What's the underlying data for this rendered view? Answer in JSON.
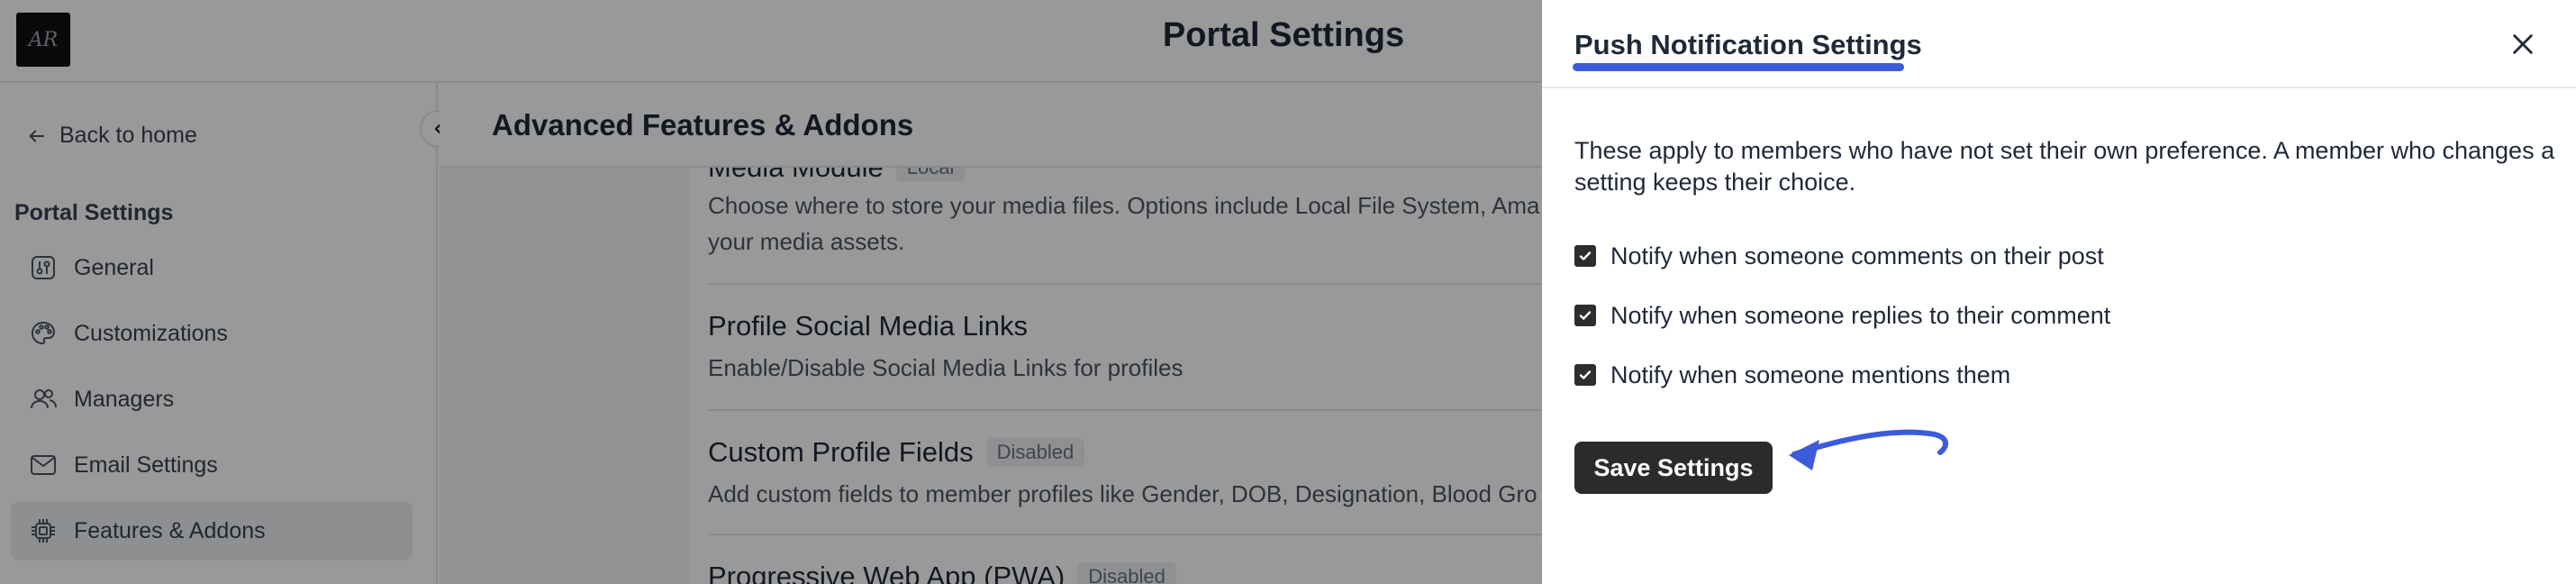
{
  "app": {
    "logo_text": "AR",
    "title": "Portal Settings"
  },
  "sidebar": {
    "back_label": "Back to home",
    "heading": "Portal Settings",
    "items": [
      {
        "label": "General",
        "icon": "general-settings-icon",
        "active": false
      },
      {
        "label": "Customizations",
        "icon": "palette-icon",
        "active": false
      },
      {
        "label": "Managers",
        "icon": "users-icon",
        "active": false
      },
      {
        "label": "Email Settings",
        "icon": "mail-icon",
        "active": false
      },
      {
        "label": "Features & Addons",
        "icon": "chip-icon",
        "active": true
      }
    ]
  },
  "main": {
    "section_title": "Advanced Features & Addons",
    "features": [
      {
        "title": "Media Module",
        "badge": "Local",
        "description": "Choose where to store your media files. Options include Local File System, Ama",
        "description_2": "your media assets."
      },
      {
        "title": "Profile Social Media Links",
        "badge": "",
        "description": "Enable/Disable Social Media Links for profiles"
      },
      {
        "title": "Custom Profile Fields",
        "badge": "Disabled",
        "description": "Add custom fields to member profiles like Gender, DOB, Designation, Blood Gro"
      },
      {
        "title": "Progressive Web App (PWA)",
        "badge": "Disabled",
        "description": ""
      }
    ]
  },
  "drawer": {
    "title": "Push Notification Settings",
    "intro": "These apply to members who have not set their own preference. A member who changes a setting keeps their choice.",
    "options": [
      {
        "label": "Notify when someone comments on their post",
        "checked": true
      },
      {
        "label": "Notify when someone replies to their comment",
        "checked": true
      },
      {
        "label": "Notify when someone mentions them",
        "checked": true
      }
    ],
    "save_label": "Save Settings",
    "annotation_color": "#3b5bdb"
  }
}
